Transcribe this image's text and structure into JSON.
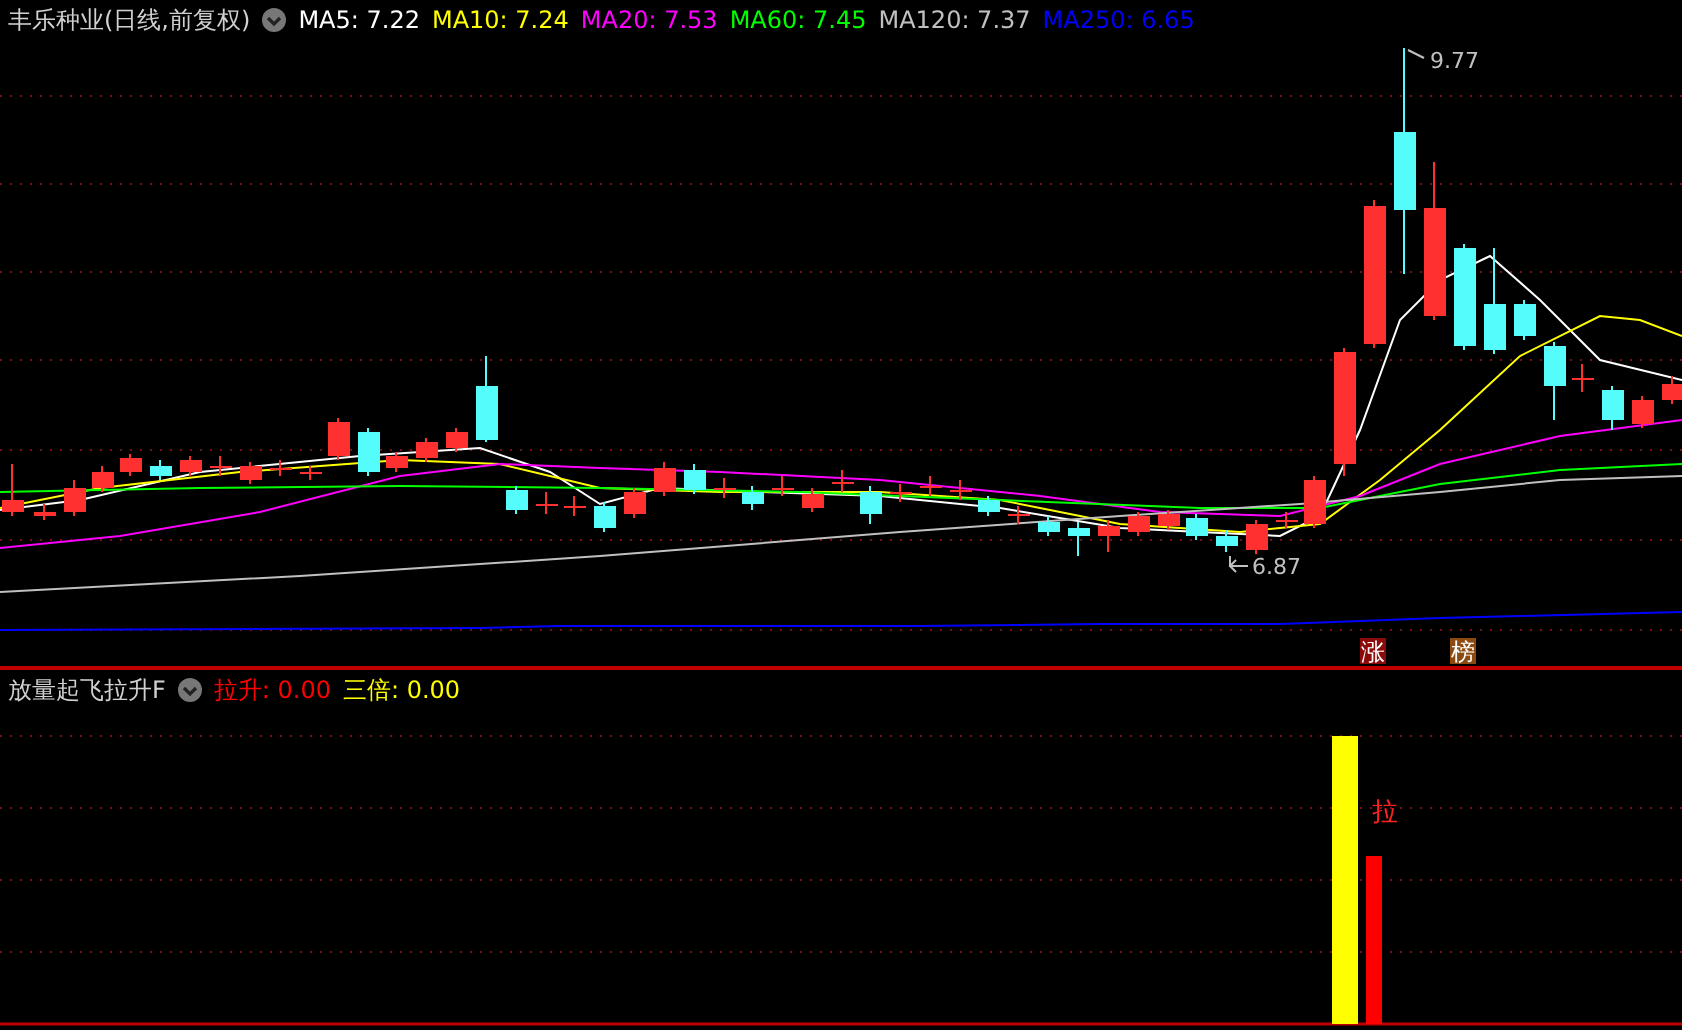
{
  "main_panel": {
    "title": "丰乐种业(日线,前复权)",
    "moving_averages": [
      {
        "label": "MA5:",
        "value": "7.22",
        "color": "#ffffff"
      },
      {
        "label": "MA10:",
        "value": "7.24",
        "color": "#ffff00"
      },
      {
        "label": "MA20:",
        "value": "7.53",
        "color": "#ff00ff"
      },
      {
        "label": "MA60:",
        "value": "7.45",
        "color": "#00ff00"
      },
      {
        "label": "MA120:",
        "value": "7.37",
        "color": "#c0c0c0"
      },
      {
        "label": "MA250:",
        "value": "6.65",
        "color": "#0000ff"
      }
    ],
    "high_label": "9.77",
    "low_label": "6.87",
    "badges": [
      {
        "text": "涨",
        "color": "#8b0a0a"
      },
      {
        "text": "榜",
        "color": "#8b4a10"
      }
    ]
  },
  "indicator_panel": {
    "title": "放量起飞拉升F",
    "values": [
      {
        "label": "拉升:",
        "value": "0.00",
        "color": "#ff0000"
      },
      {
        "label": "三倍:",
        "value": "0.00",
        "color": "#ffff00"
      }
    ],
    "bar_label": "拉"
  }
}
